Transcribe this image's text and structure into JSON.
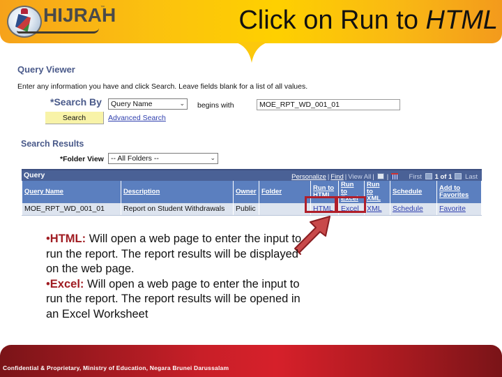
{
  "slide": {
    "logo_text": "HIJRAH",
    "title_plain": "Click on Run to ",
    "title_italic": "HTML"
  },
  "query_viewer": {
    "heading": "Query Viewer",
    "instructions": "Enter any information you have and click Search. Leave fields blank for a list of all values.",
    "search_by_label": "*Search By",
    "search_by_value": "Query Name",
    "operator_label": "begins with",
    "search_value": "MOE_RPT_WD_001_01",
    "search_button": "Search",
    "advanced_search_link": "Advanced Search"
  },
  "search_results": {
    "heading": "Search Results",
    "folder_view_label": "*Folder View",
    "folder_view_value": "-- All Folders --"
  },
  "grid": {
    "title": "Query",
    "nav": {
      "personalize": "Personalize",
      "find": "Find",
      "view_all": "View All",
      "zoom_icon": "zoom-icon",
      "download_icon": "download-grid-icon",
      "first": "First",
      "count": "1 of 1",
      "last": "Last"
    },
    "columns": [
      {
        "line1": "Query Name",
        "line2": ""
      },
      {
        "line1": "Description",
        "line2": ""
      },
      {
        "line1": "Owner",
        "line2": ""
      },
      {
        "line1": "Folder",
        "line2": ""
      },
      {
        "line1": "Run to",
        "line2": "HTML"
      },
      {
        "line1": "Run to",
        "line2": "Excel"
      },
      {
        "line1": "Run to",
        "line2": "XML"
      },
      {
        "line1": "Schedule",
        "line2": ""
      },
      {
        "line1": "Add to",
        "line2": "Favorites"
      }
    ],
    "rows": [
      {
        "query_name": "MOE_RPT_WD_001_01",
        "description": "Report on Student Withdrawals",
        "owner": "Public",
        "folder": "",
        "run_html": "HTML",
        "run_excel": "Excel",
        "run_xml": "XML",
        "schedule": "Schedule",
        "favorite": "Favorite"
      }
    ]
  },
  "notes": [
    {
      "bullet": "•",
      "keyword": "HTML:",
      "text": " Will open a web page to enter the input to run the report. The report results will be displayed on the web page."
    },
    {
      "bullet": "•",
      "keyword": "Excel:",
      "text": " Will open a web page to enter the input to run the report. The report results will be opened in an Excel Worksheet"
    }
  ],
  "footer": {
    "text": "Confidential & Proprietary, Ministry of Education, Negara Brunei Darussalam"
  },
  "colors": {
    "banner_yellow": "#fed000",
    "heading_blue": "#4a5a8a",
    "grid_header": "#5b7fbf",
    "highlight_red": "#b01e2a",
    "footer_red": "#c81f28"
  }
}
